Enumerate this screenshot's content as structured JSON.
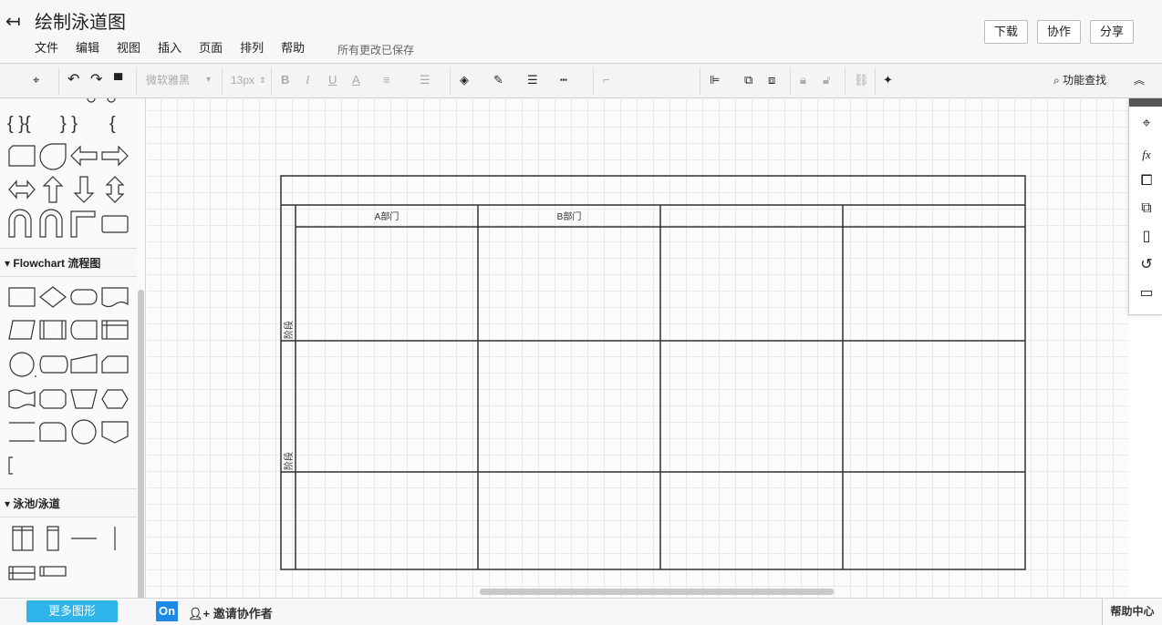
{
  "header": {
    "title": "绘制泳道图",
    "menu": [
      "文件",
      "编辑",
      "视图",
      "插入",
      "页面",
      "排列",
      "帮助"
    ],
    "saved_status": "所有更改已保存",
    "download": "下载",
    "collaborate": "协作",
    "share": "分享"
  },
  "toolbar": {
    "font_family": "微软雅黑",
    "font_size": "13px",
    "bold": "B",
    "italic": "I",
    "underline": "U",
    "font_color": "A",
    "search_label": "功能查找"
  },
  "sidebar": {
    "flowchart_title": "Flowchart 流程图",
    "swimlane_title": "泳池/泳道",
    "more_shapes": "更多图形"
  },
  "footer": {
    "on_badge": "On",
    "invite": "邀请协作者",
    "help_center": "帮助中心"
  },
  "diagram": {
    "columns": [
      "A部门",
      "B部门",
      "",
      ""
    ],
    "rows": [
      "阶段",
      "阶段",
      ""
    ]
  }
}
